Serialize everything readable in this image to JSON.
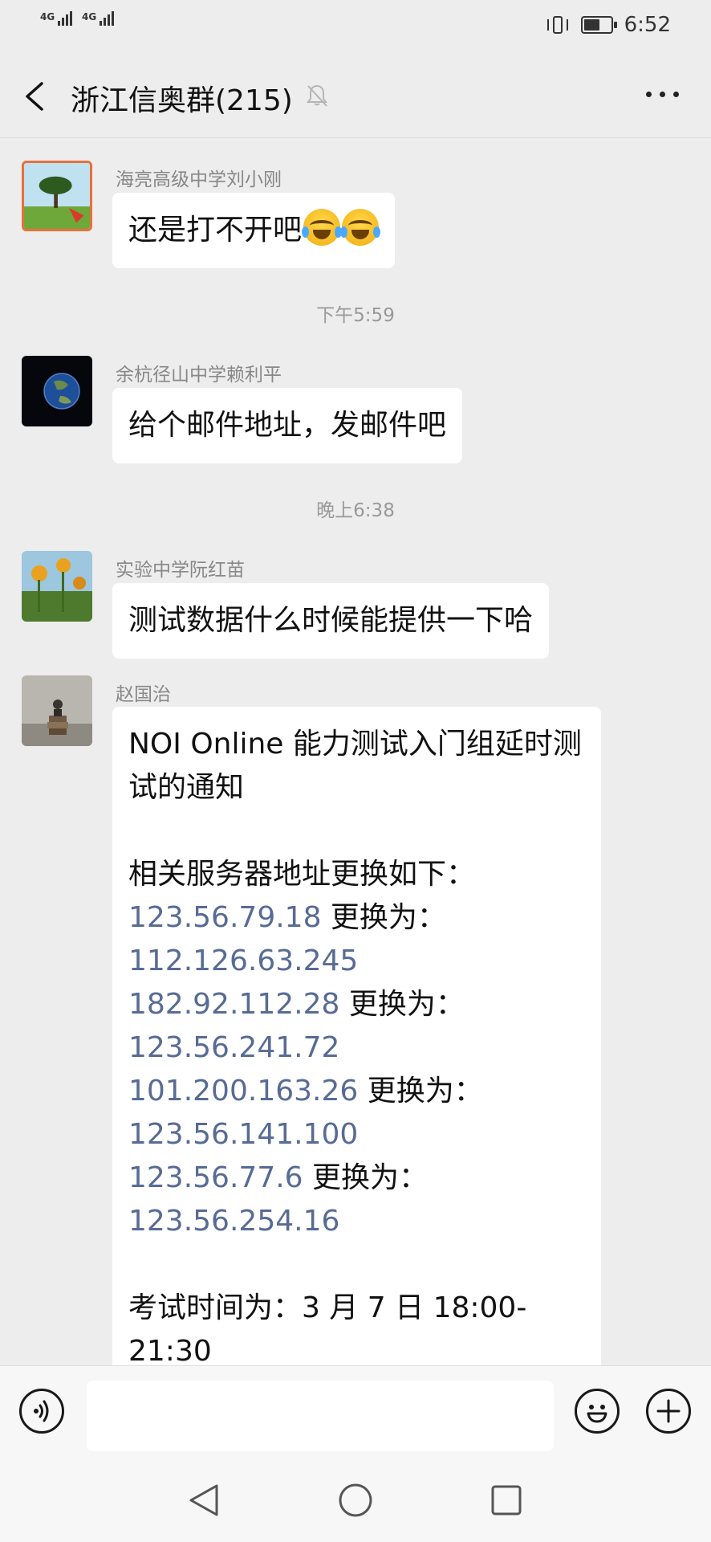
{
  "status_bar": {
    "signal1_label": "4G",
    "signal2_label": "4G",
    "time": "6:52"
  },
  "chat": {
    "title": "浙江信奥群(215)",
    "icons": {
      "back": "chevron-left-icon",
      "muted": "bell-off-icon",
      "more": "more-dots-icon"
    }
  },
  "messages": [
    {
      "sender": "海亮高级中学刘小刚",
      "text": "还是打不开吧",
      "emoji_count": 2
    },
    {
      "timestamp": "下午5:59"
    },
    {
      "sender": "余杭径山中学赖利平",
      "text": "给个邮件地址，发邮件吧"
    },
    {
      "timestamp": "晚上6:38"
    },
    {
      "sender": "实验中学阮红苗",
      "text": "测试数据什么时候能提供一下哈"
    },
    {
      "sender": "赵国治",
      "title_line1": "NOI Online 能力测试入门组延时测",
      "title_line2": "试的通知",
      "intro": "相关服务器地址更换如下：",
      "replace_word": " 更换为：",
      "changes": [
        {
          "from": "123.56.79.18",
          "to": "112.126.63.245"
        },
        {
          "from": "182.92.112.28",
          "to": "123.56.241.72"
        },
        {
          "from": "101.200.163.26",
          "to": "123.56.141.100"
        },
        {
          "from": "123.56.77.6",
          "to": "123.56.254.16"
        }
      ],
      "exam_time": "考试时间为：3 月 7 日 18:00-21:30"
    }
  ],
  "input_bar": {
    "icons": {
      "voice": "voice-icon",
      "emoji": "emoji-icon",
      "add": "plus-icon"
    }
  },
  "system_nav": {
    "icons": {
      "back": "nav-back-icon",
      "home": "nav-home-icon",
      "recents": "nav-recents-icon"
    }
  },
  "colors": {
    "link": "#576b95",
    "background": "#ededed",
    "bubble": "#ffffff"
  }
}
